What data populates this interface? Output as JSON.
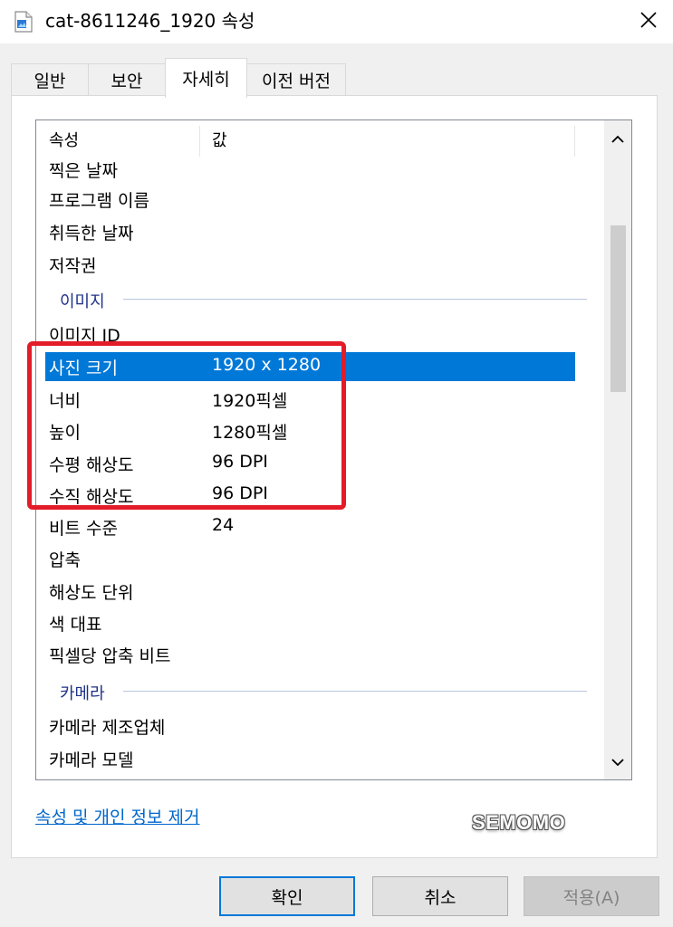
{
  "window": {
    "title": "cat-8611246_1920 속성",
    "icon": "image-file-icon",
    "close_glyph": "✕"
  },
  "tabs": [
    {
      "label": "일반",
      "active": false
    },
    {
      "label": "보안",
      "active": false
    },
    {
      "label": "자세히",
      "active": true
    },
    {
      "label": "이전 버전",
      "active": false
    }
  ],
  "listview": {
    "columns": [
      "속성",
      "값"
    ],
    "rows": [
      {
        "kind": "item",
        "property": "찍은 날짜",
        "value": ""
      },
      {
        "kind": "item",
        "property": "프로그램 이름",
        "value": ""
      },
      {
        "kind": "item",
        "property": "취득한 날짜",
        "value": ""
      },
      {
        "kind": "item",
        "property": "저작권",
        "value": ""
      },
      {
        "kind": "group",
        "label": "이미지"
      },
      {
        "kind": "item",
        "property": "이미지 ID",
        "value": ""
      },
      {
        "kind": "item",
        "property": "사진 크기",
        "value": "1920 x 1280",
        "selected": true
      },
      {
        "kind": "item",
        "property": "너비",
        "value": "1920픽셀"
      },
      {
        "kind": "item",
        "property": "높이",
        "value": "1280픽셀"
      },
      {
        "kind": "item",
        "property": "수평 해상도",
        "value": "96 DPI"
      },
      {
        "kind": "item",
        "property": "수직 해상도",
        "value": "96 DPI"
      },
      {
        "kind": "item",
        "property": "비트 수준",
        "value": "24"
      },
      {
        "kind": "item",
        "property": "압축",
        "value": ""
      },
      {
        "kind": "item",
        "property": "해상도 단위",
        "value": ""
      },
      {
        "kind": "item",
        "property": "색 대표",
        "value": ""
      },
      {
        "kind": "item",
        "property": "픽셀당 압축 비트",
        "value": ""
      },
      {
        "kind": "group",
        "label": "카메라"
      },
      {
        "kind": "item",
        "property": "카메라 제조업체",
        "value": ""
      },
      {
        "kind": "item",
        "property": "카메라 모델",
        "value": ""
      }
    ]
  },
  "remove_properties_link": "속성 및 개인 정보 제거",
  "watermark": "SEMOMO",
  "buttons": {
    "ok": "확인",
    "cancel": "취소",
    "apply": "적용(A)"
  },
  "colors": {
    "selection": "#0078d7",
    "highlight_border": "#e31c29",
    "group_text": "#1e3287",
    "link": "#0066cc"
  }
}
